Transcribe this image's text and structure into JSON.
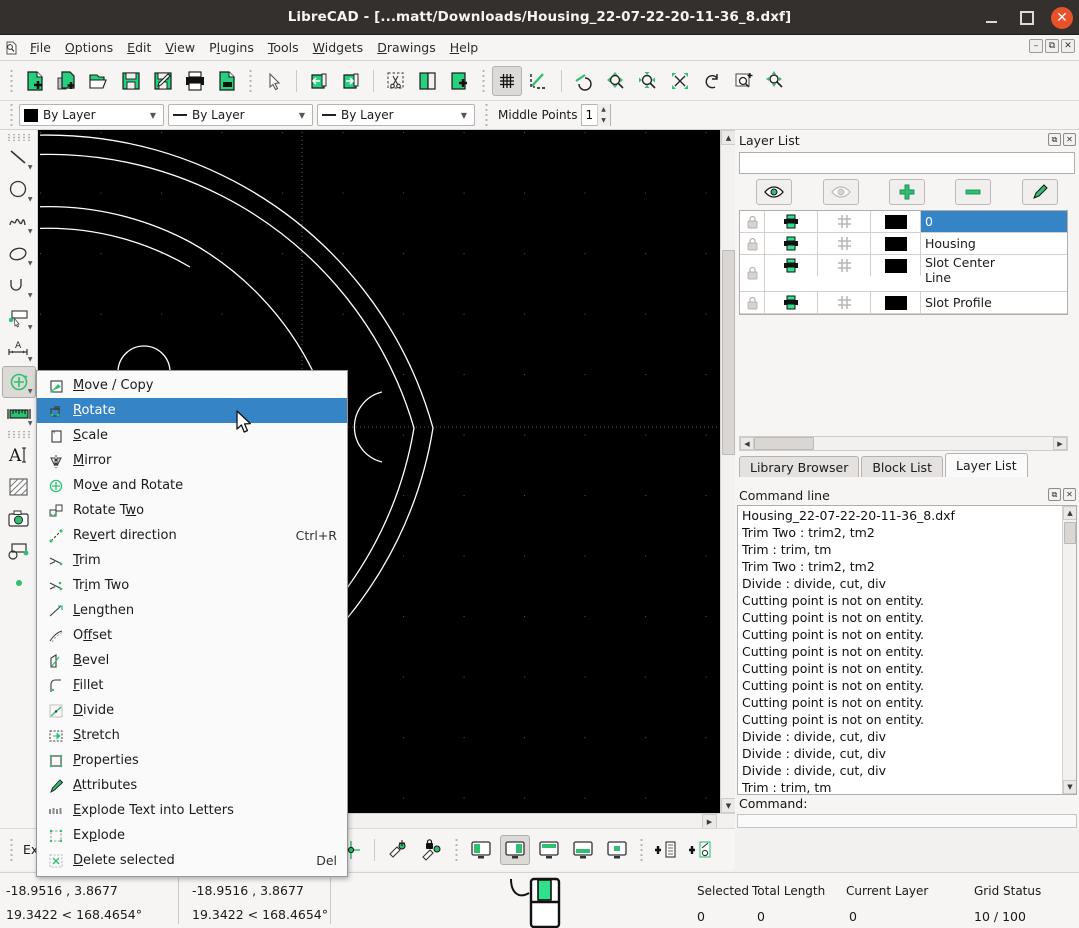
{
  "window": {
    "title": "LibreCAD - [...matt/Downloads/Housing_22-07-22-20-11-36_8.dxf]",
    "minimize_label": "",
    "maximize_label": "",
    "close_label": "✕"
  },
  "menubar": {
    "app_icon": "document-icon",
    "items": [
      {
        "label": "File",
        "mnemonic": "F"
      },
      {
        "label": "Options",
        "mnemonic": "O"
      },
      {
        "label": "Edit",
        "mnemonic": "E"
      },
      {
        "label": "View",
        "mnemonic": "V"
      },
      {
        "label": "Plugins",
        "mnemonic": "l"
      },
      {
        "label": "Tools",
        "mnemonic": "T"
      },
      {
        "label": "Widgets",
        "mnemonic": "W"
      },
      {
        "label": "Drawings",
        "mnemonic": "D"
      },
      {
        "label": "Help",
        "mnemonic": "H"
      }
    ],
    "mdi_buttons": [
      "minimize-mdi",
      "restore-mdi",
      "close-mdi"
    ]
  },
  "toolbar": {
    "buttons": [
      {
        "name": "new-file-icon",
        "tooltip": "New"
      },
      {
        "name": "new-from-template-icon",
        "tooltip": "New from template"
      },
      {
        "name": "open-file-icon",
        "tooltip": "Open"
      },
      {
        "name": "save-icon",
        "tooltip": "Save"
      },
      {
        "name": "save-as-icon",
        "tooltip": "Save as"
      },
      {
        "name": "print-icon",
        "tooltip": "Print"
      },
      {
        "name": "print-preview-icon",
        "tooltip": "Print preview"
      },
      {
        "name": "select-pointer-icon",
        "tooltip": "Select"
      },
      {
        "name": "undo-icon",
        "tooltip": "Undo"
      },
      {
        "name": "redo-icon",
        "tooltip": "Redo"
      },
      {
        "name": "cut-icon",
        "tooltip": "Cut"
      },
      {
        "name": "copy-icon",
        "tooltip": "Copy"
      },
      {
        "name": "paste-icon",
        "tooltip": "Paste"
      },
      {
        "name": "grid-toggle-icon",
        "tooltip": "Grid",
        "active": true
      },
      {
        "name": "draft-mode-icon",
        "tooltip": "Draft mode"
      },
      {
        "name": "zoom-previous-icon",
        "tooltip": "Zoom previous"
      },
      {
        "name": "zoom-in-icon",
        "tooltip": "Zoom in"
      },
      {
        "name": "zoom-out-icon",
        "tooltip": "Zoom out"
      },
      {
        "name": "zoom-auto-icon",
        "tooltip": "Zoom auto"
      },
      {
        "name": "zoom-redraw-icon",
        "tooltip": "Redraw"
      },
      {
        "name": "zoom-window-icon",
        "tooltip": "Zoom window"
      },
      {
        "name": "zoom-pan-icon",
        "tooltip": "Pan zoom"
      }
    ]
  },
  "attrbar": {
    "color_combo": {
      "value": "By Layer",
      "swatch": "#000000"
    },
    "width_combo": {
      "value": "By Layer"
    },
    "linetype_combo": {
      "value": "By Layer"
    },
    "middle_points_label": "Middle Points",
    "middle_points_value": "1"
  },
  "left_tools": [
    {
      "name": "line-tool",
      "glyph": "line"
    },
    {
      "name": "circle-tool",
      "glyph": "circle"
    },
    {
      "name": "spline-tool",
      "glyph": "spline"
    },
    {
      "name": "ellipse-tool",
      "glyph": "ellipse"
    },
    {
      "name": "arc-tool",
      "glyph": "arc"
    },
    {
      "name": "polyline-tool",
      "glyph": "polyline"
    },
    {
      "name": "dimension-tool",
      "glyph": "dimension"
    },
    {
      "name": "modify-tool",
      "glyph": "modify",
      "active": true
    },
    {
      "name": "measure-tool",
      "glyph": "measure"
    },
    {
      "name": "text-tool",
      "glyph": "text"
    },
    {
      "name": "hatch-tool",
      "glyph": "hatch"
    },
    {
      "name": "image-tool",
      "glyph": "image"
    },
    {
      "name": "block-tool",
      "glyph": "block"
    },
    {
      "name": "point-tool",
      "glyph": "point"
    }
  ],
  "context_menu": {
    "items": [
      {
        "label": "Move / Copy",
        "mnemonic": "M",
        "shortcut": "",
        "icon": "move-copy-icon",
        "highlighted": false
      },
      {
        "label": "Rotate",
        "mnemonic": "R",
        "shortcut": "",
        "icon": "rotate-icon",
        "highlighted": true
      },
      {
        "label": "Scale",
        "mnemonic": "S",
        "shortcut": "",
        "icon": "scale-icon",
        "highlighted": false
      },
      {
        "label": "Mirror",
        "mnemonic": "M",
        "shortcut": "",
        "icon": "mirror-icon",
        "highlighted": false
      },
      {
        "label": "Move and Rotate",
        "mnemonic": "v",
        "shortcut": "",
        "icon": "move-and-rotate-icon",
        "highlighted": false
      },
      {
        "label": "Rotate Two",
        "mnemonic": "w",
        "shortcut": "",
        "icon": "rotate-two-icon",
        "highlighted": false
      },
      {
        "label": "Revert direction",
        "mnemonic": "v",
        "shortcut": "Ctrl+R",
        "icon": "revert-direction-icon",
        "highlighted": false
      },
      {
        "label": "Trim",
        "mnemonic": "T",
        "shortcut": "",
        "icon": "trim-icon",
        "highlighted": false
      },
      {
        "label": "Trim Two",
        "mnemonic": "i",
        "shortcut": "",
        "icon": "trim-two-icon",
        "highlighted": false
      },
      {
        "label": "Lengthen",
        "mnemonic": "L",
        "shortcut": "",
        "icon": "lengthen-icon",
        "highlighted": false
      },
      {
        "label": "Offset",
        "mnemonic": "f",
        "shortcut": "",
        "icon": "offset-icon",
        "highlighted": false
      },
      {
        "label": "Bevel",
        "mnemonic": "B",
        "shortcut": "",
        "icon": "bevel-icon",
        "highlighted": false
      },
      {
        "label": "Fillet",
        "mnemonic": "F",
        "shortcut": "",
        "icon": "fillet-icon",
        "highlighted": false
      },
      {
        "label": "Divide",
        "mnemonic": "D",
        "shortcut": "",
        "icon": "divide-icon",
        "highlighted": false
      },
      {
        "label": "Stretch",
        "mnemonic": "S",
        "shortcut": "",
        "icon": "stretch-icon",
        "highlighted": false
      },
      {
        "label": "Properties",
        "mnemonic": "P",
        "shortcut": "",
        "icon": "properties-icon",
        "highlighted": false
      },
      {
        "label": "Attributes",
        "mnemonic": "A",
        "shortcut": "",
        "icon": "attributes-icon",
        "highlighted": false
      },
      {
        "label": "Explode Text into Letters",
        "mnemonic": "E",
        "shortcut": "",
        "icon": "explode-text-icon",
        "highlighted": false
      },
      {
        "label": "Explode",
        "mnemonic": "p",
        "shortcut": "",
        "icon": "explode-icon",
        "highlighted": false
      },
      {
        "label": "Delete selected",
        "mnemonic": "D",
        "shortcut": "Del",
        "icon": "delete-selected-icon",
        "highlighted": false
      }
    ]
  },
  "layer_panel": {
    "title": "Layer List",
    "filter_value": "",
    "tool_buttons": [
      {
        "name": "show-all-layers-button",
        "icon": "eye-icon"
      },
      {
        "name": "hide-all-layers-button",
        "icon": "eye-dim-icon"
      },
      {
        "name": "add-layer-button",
        "icon": "plus-icon"
      },
      {
        "name": "remove-layer-button",
        "icon": "minus-icon"
      },
      {
        "name": "edit-layer-button",
        "icon": "pencil-icon"
      }
    ],
    "columns": [
      "lock",
      "print",
      "construction",
      "color",
      "name"
    ],
    "rows": [
      {
        "name": "0",
        "selected": true,
        "color": "#000000",
        "locked": false,
        "printable": true
      },
      {
        "name": "Housing",
        "selected": false,
        "color": "#000000",
        "locked": false,
        "printable": true
      },
      {
        "name": "Slot Center Line",
        "selected": false,
        "color": "#000000",
        "locked": false,
        "printable": true
      },
      {
        "name": "Slot Profile",
        "selected": false,
        "color": "#000000",
        "locked": false,
        "printable": true
      }
    ]
  },
  "dock_tabs": [
    {
      "label": "Library Browser",
      "active": false
    },
    {
      "label": "Block List",
      "active": false
    },
    {
      "label": "Layer List",
      "active": true
    }
  ],
  "command_panel": {
    "title": "Command line",
    "history": [
      "Housing_22-07-22-20-11-36_8.dxf",
      "Trim Two : trim2, tm2",
      "Trim : trim, tm",
      "Trim Two : trim2, tm2",
      "Divide : divide, cut, div",
      "Cutting point is not on entity.",
      "Cutting point is not on entity.",
      "Cutting point is not on entity.",
      "Cutting point is not on entity.",
      "Cutting point is not on entity.",
      "Cutting point is not on entity.",
      "Cutting point is not on entity.",
      "Cutting point is not on entity.",
      "Divide : divide, cut, div",
      "Divide : divide, cut, div",
      "Divide : divide, cut, div",
      "Trim : trim, tm"
    ],
    "prompt": "Command:"
  },
  "bottom_toolbar": {
    "hidden_label": "Ex",
    "buttons": [
      {
        "name": "snap-middle-icon"
      },
      {
        "name": "snap-intersection-icon"
      },
      {
        "name": "snap-free-icon"
      },
      {
        "name": "snap-lock-icon"
      },
      {
        "name": "view-layout-1-icon"
      },
      {
        "name": "view-layout-2-icon",
        "active": true
      },
      {
        "name": "view-layout-3-icon"
      },
      {
        "name": "view-layout-4-icon"
      },
      {
        "name": "view-layout-5-icon"
      },
      {
        "name": "add-text-icon"
      },
      {
        "name": "add-entity-icon"
      }
    ]
  },
  "statusbar": {
    "abs_coord": "-18.9516 , 3.8677",
    "abs_polar": "19.3422 < 168.4654°",
    "rel_coord": "-18.9516 , 3.8677",
    "rel_polar": "19.3422 < 168.4654°",
    "mouse_widget": "mouse-hint-icon",
    "fields": [
      {
        "label": "Selected",
        "value": "0"
      },
      {
        "label": "Total Length",
        "value": "0"
      },
      {
        "label": "Current Layer",
        "value": "0"
      },
      {
        "label": "Grid Status",
        "value": "10 / 100"
      }
    ]
  },
  "canvas": {
    "background": "#000000",
    "stroke": "#ffffff",
    "grid_color": "#4d4d4d",
    "description": "CAD drawing of a large circular housing with concentric arcs and two slot features"
  }
}
